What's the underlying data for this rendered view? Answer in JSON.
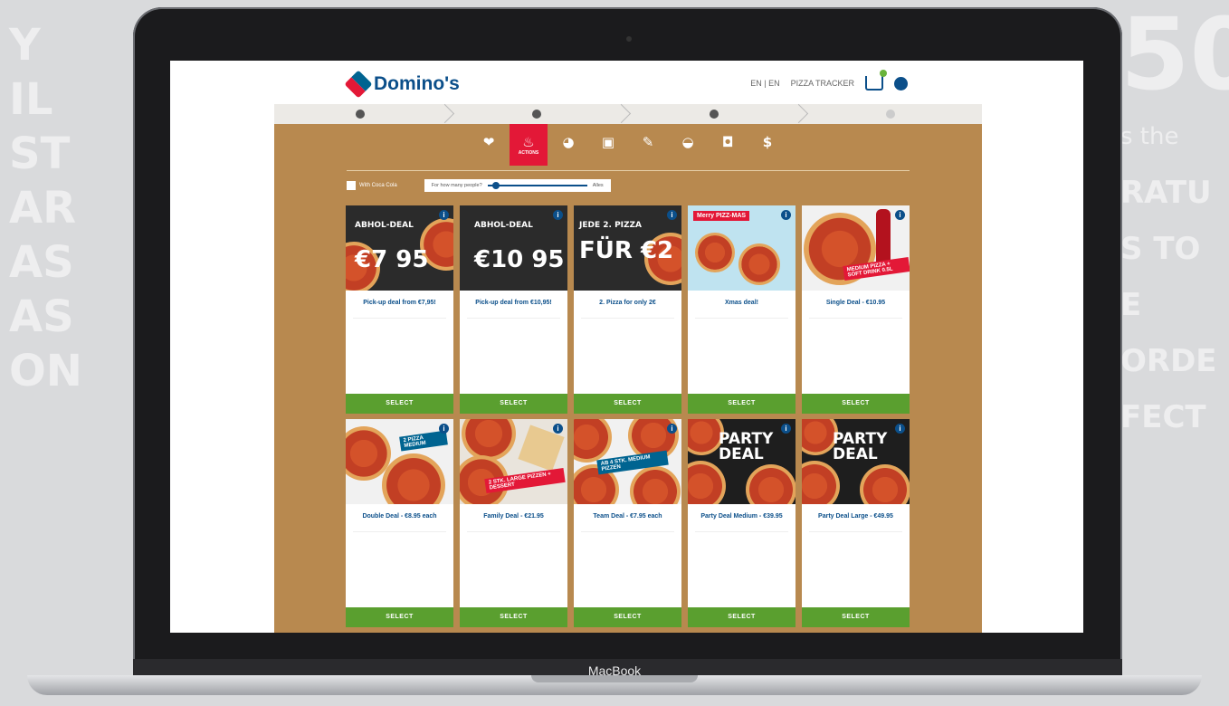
{
  "background": {
    "left_letters": [
      "Y",
      "IL",
      "ST",
      "AR",
      "AS",
      "AS",
      "ON"
    ],
    "right_letters": [
      "50",
      "s the",
      "RATU",
      "S TO E",
      "ORDE",
      "FECT"
    ]
  },
  "device": {
    "brand": "MacBook"
  },
  "header": {
    "logo_text": "Domino's",
    "lang": "EN | EN",
    "tracker": "PIZZA TRACKER"
  },
  "steps": [
    "",
    "",
    "",
    ""
  ],
  "categories": [
    {
      "icon": "heart-icon",
      "glyph": "❤"
    },
    {
      "icon": "flame-icon",
      "glyph": "🔥",
      "label": "ACTIONS",
      "active": true
    },
    {
      "icon": "pizza-icon",
      "glyph": "◕"
    },
    {
      "icon": "box-icon",
      "glyph": "▣"
    },
    {
      "icon": "spoon-icon",
      "glyph": "✎"
    },
    {
      "icon": "bowl-icon",
      "glyph": "◒"
    },
    {
      "icon": "cake-icon",
      "glyph": "◘"
    },
    {
      "icon": "drink-icon",
      "glyph": "$"
    }
  ],
  "filters": {
    "checkbox_label": "With Coca Cola",
    "people_label": "For how many people?",
    "people_value": "Alles",
    "slider_level": 0.05
  },
  "colors": {
    "brand_blue": "#0b4f8a",
    "brand_red": "#e31837",
    "button_green": "#5a9f2f",
    "board_brown": "#b8894f"
  },
  "cards": [
    {
      "promo_top": "ABHOL-DEAL",
      "promo_big": "€7 95",
      "title": "Pick-up deal from €7,95!",
      "desc": "",
      "button": "SELECT"
    },
    {
      "promo_top": "ABHOL-DEAL",
      "promo_big": "€10 95",
      "title": "Pick-up deal from €10,95!",
      "desc": "",
      "button": "SELECT"
    },
    {
      "promo_top": "JEDE 2. PIZZA",
      "promo_big": "FÜR €2",
      "title": "2. Pizza for only 2€",
      "desc": "",
      "button": "SELECT"
    },
    {
      "promo_top": "Merry PIZZ-MAS",
      "promo_big": "",
      "title": "Xmas deal!",
      "desc": "",
      "button": "SELECT"
    },
    {
      "promo_top": "MEDIUM PIZZA + SOFT DRINK 0.5L",
      "promo_big": "",
      "title": "Single Deal - €10.95",
      "desc": "",
      "button": "SELECT"
    },
    {
      "promo_top": "2 PIZZA MEDIUM",
      "promo_big": "",
      "title": "Double Deal - €8.95 each",
      "desc": "",
      "button": "SELECT"
    },
    {
      "promo_top": "2 STK. LARGE PIZZEN + DESSERT",
      "promo_big": "",
      "title": "Family Deal - €21.95",
      "desc": "",
      "button": "SELECT"
    },
    {
      "promo_top": "AB 4 STK. MEDIUM PIZZEN",
      "promo_big": "",
      "title": "Team Deal - €7.95 each",
      "desc": "",
      "button": "SELECT"
    },
    {
      "promo_top": "PARTY DEAL",
      "promo_big": "",
      "title": "Party Deal Medium - €39.95",
      "desc": "",
      "button": "SELECT"
    },
    {
      "promo_top": "PARTY DEAL",
      "promo_big": "",
      "title": "Party Deal Large - €49.95",
      "desc": "",
      "button": "SELECT"
    }
  ]
}
